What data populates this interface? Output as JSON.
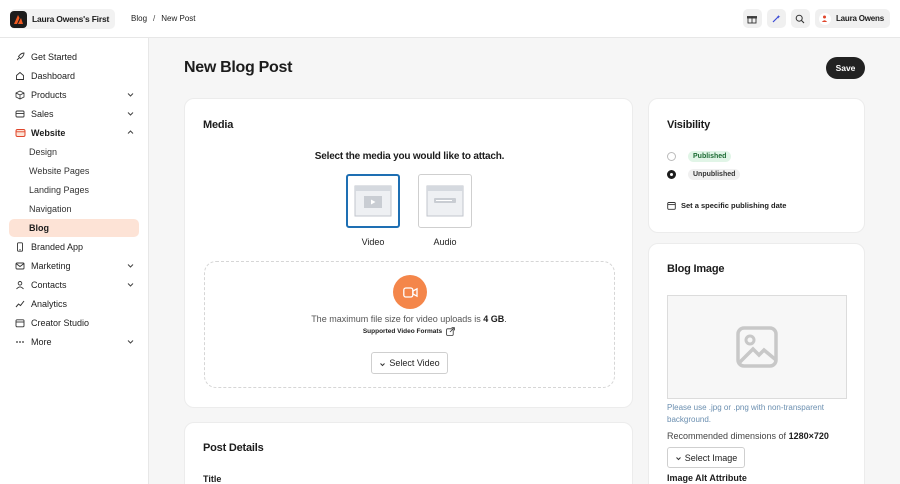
{
  "app": {
    "brand_name": "Laura Owens's First",
    "user_name": "Laura Owens",
    "accent_color": "#f4864a",
    "breadcrumb": [
      "Blog",
      "New Post"
    ],
    "breadcrumb_sep": "/",
    "top_icons": [
      "gift-icon",
      "sparkle-icon",
      "search-icon"
    ]
  },
  "sidebar": {
    "items": [
      {
        "label": "Get Started",
        "icon": "rocket-icon"
      },
      {
        "label": "Dashboard",
        "icon": "home-icon"
      },
      {
        "label": "Products",
        "icon": "box-icon",
        "chevron": "down"
      },
      {
        "label": "Sales",
        "icon": "sales-icon",
        "chevron": "down"
      },
      {
        "label": "Website",
        "icon": "website-icon",
        "chevron": "up",
        "expanded": true
      },
      {
        "label": "Branded App",
        "icon": "phone-icon"
      },
      {
        "label": "Marketing",
        "icon": "mail-icon",
        "chevron": "down"
      },
      {
        "label": "Contacts",
        "icon": "contacts-icon",
        "chevron": "down"
      },
      {
        "label": "Analytics",
        "icon": "analytics-icon"
      },
      {
        "label": "Creator Studio",
        "icon": "calendar-icon"
      },
      {
        "label": "More",
        "icon": "more-icon",
        "chevron": "down"
      }
    ],
    "website_sub": [
      "Design",
      "Website Pages",
      "Landing Pages",
      "Navigation",
      "Blog"
    ],
    "active_sub": "Blog"
  },
  "main": {
    "title": "New Blog Post",
    "save_label": "Save"
  },
  "media": {
    "title": "Media",
    "prompt": "Select the media you would like to attach.",
    "options": [
      {
        "label": "Video",
        "selected": true
      },
      {
        "label": "Audio",
        "selected": false
      }
    ],
    "max_text_prefix": "The maximum file size for video uploads is",
    "max_size": "4 GB",
    "max_text_suffix": ".",
    "formats_link": "Supported Video Formats",
    "select_label": "Select Video"
  },
  "post_details": {
    "title": "Post Details",
    "field_title": "Title"
  },
  "visibility": {
    "title": "Visibility",
    "options": [
      {
        "label": "Published",
        "selected": false
      },
      {
        "label": "Unpublished",
        "selected": true
      }
    ],
    "schedule_label": "Set a specific publishing date"
  },
  "blog_image": {
    "title": "Blog Image",
    "note": "Please use .jpg or .png with non-transparent background.",
    "dims_prefix": "Recommended dimensions of",
    "dims_value": "1280×720",
    "select_label": "Select Image",
    "alt_label": "Image Alt Attribute"
  }
}
